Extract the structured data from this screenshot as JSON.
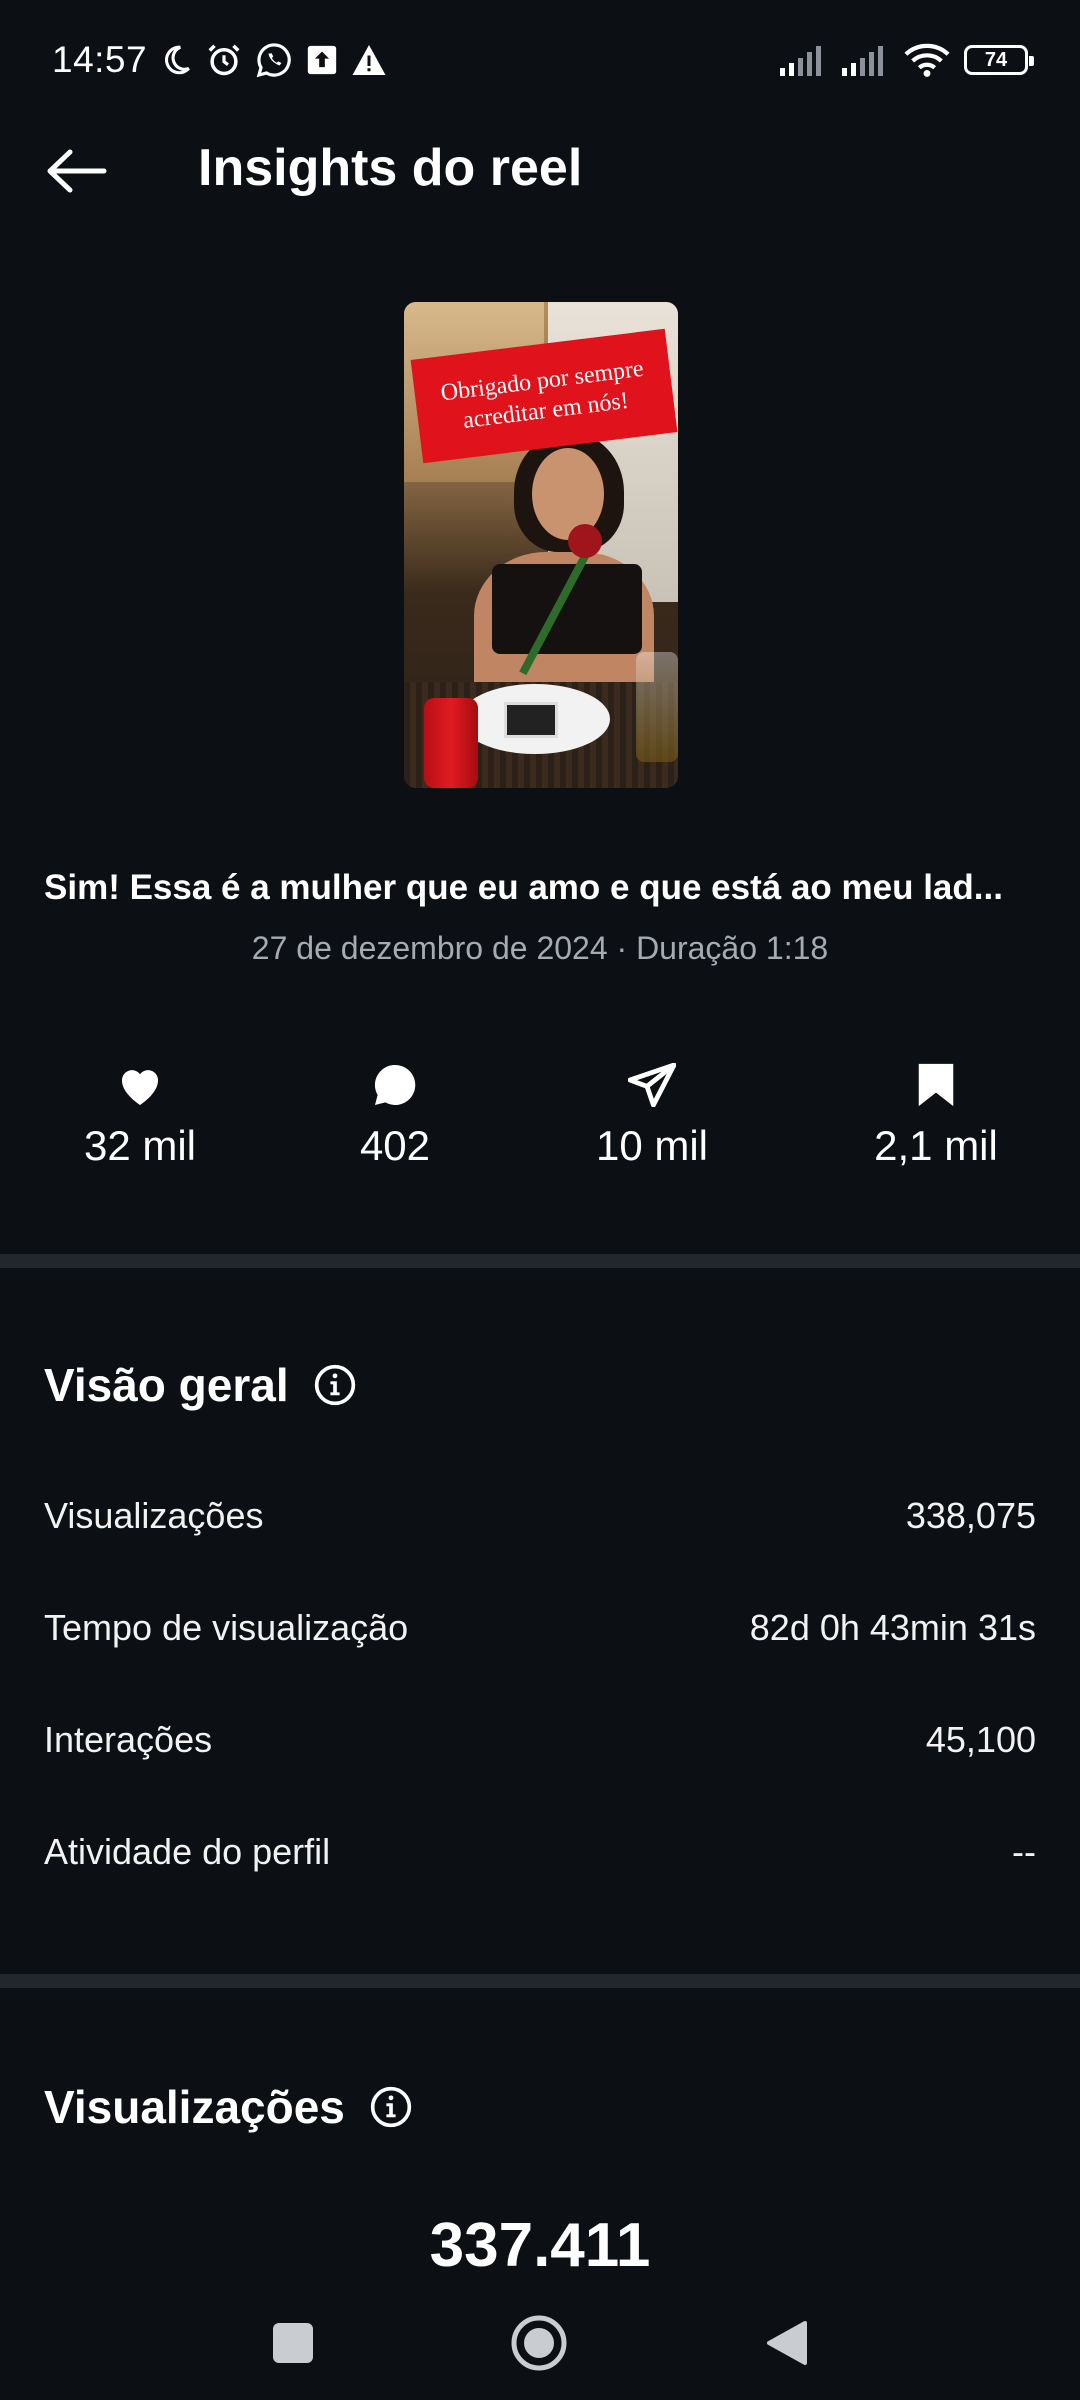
{
  "status_bar": {
    "time": "14:57",
    "battery": "74",
    "icons": [
      "moon-icon",
      "alarm-icon",
      "whatsapp-icon",
      "upload-icon",
      "warning-icon",
      "signal-icon",
      "signal-icon",
      "wifi-icon",
      "battery-icon"
    ]
  },
  "header": {
    "title": "Insights do reel"
  },
  "thumbnail": {
    "caption_text": "Obrigado por sempre acreditar em nós!"
  },
  "post": {
    "caption": "Sim! Essa é a mulher que eu amo e que está ao meu lad...",
    "meta": "27 de dezembro de 2024 · Duração 1:18"
  },
  "stats": [
    {
      "icon": "heart-icon",
      "value": "32 mil"
    },
    {
      "icon": "comment-icon",
      "value": "402"
    },
    {
      "icon": "share-icon",
      "value": "10 mil"
    },
    {
      "icon": "bookmark-icon",
      "value": "2,1 mil"
    }
  ],
  "overview": {
    "title": "Visão geral",
    "rows": [
      {
        "label": "Visualizações",
        "value": "338,075"
      },
      {
        "label": "Tempo de visualização",
        "value": "82d 0h 43min 31s"
      },
      {
        "label": "Interações",
        "value": "45,100"
      },
      {
        "label": "Atividade do perfil",
        "value": "--"
      }
    ]
  },
  "views_section": {
    "title": "Visualizações",
    "total": "337.411"
  },
  "colors": {
    "background": "#0c0f14",
    "divider": "#22262d",
    "muted_text": "#a6abb3",
    "caption_red": "#e0131c"
  }
}
